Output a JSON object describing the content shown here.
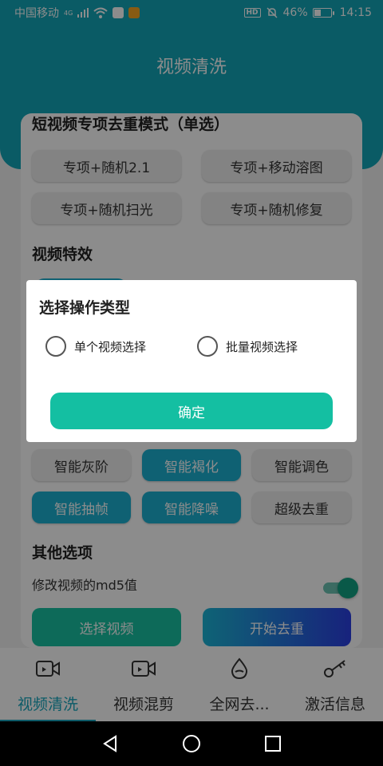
{
  "status_bar": {
    "carrier": "中国移动",
    "network": "4G",
    "battery_percent": "46%",
    "battery_level": 0.46,
    "time": "14:15",
    "hd_label": "HD"
  },
  "header": {
    "title": "视频清洗"
  },
  "sections": {
    "dedupe_mode": {
      "title": "短视频专项去重模式（单选）",
      "options": [
        "专项+随机2.1",
        "专项+移动溶图",
        "专项+随机扫光",
        "专项+随机修复"
      ]
    },
    "effects": {
      "title": "视频特效",
      "chips": [
        {
          "label": "智能灰阶",
          "active": false
        },
        {
          "label": "智能褐化",
          "active": true
        },
        {
          "label": "智能调色",
          "active": false
        },
        {
          "label": "智能抽帧",
          "active": true
        },
        {
          "label": "智能降噪",
          "active": true
        },
        {
          "label": "超级去重",
          "active": false
        }
      ]
    },
    "other": {
      "title": "其他选项",
      "md5_label": "修改视频的md5值",
      "md5_enabled": true
    }
  },
  "buttons": {
    "select_video": "选择视频",
    "start_dedupe": "开始去重"
  },
  "bottom_nav": [
    {
      "label": "视频清洗",
      "icon": "video-camera-icon",
      "active": true
    },
    {
      "label": "视频混剪",
      "icon": "video-camera-icon",
      "active": false
    },
    {
      "label": "全网去...",
      "icon": "water-drop-icon",
      "active": false
    },
    {
      "label": "激活信息",
      "icon": "key-icon",
      "active": false
    }
  ],
  "dialog": {
    "title": "选择操作类型",
    "options": [
      "单个视频选择",
      "批量视频选择"
    ],
    "confirm_label": "确定"
  },
  "colors": {
    "primary": "#13a6b8",
    "chip_active": "#1cb1d1",
    "confirm": "#14bfa2",
    "gradient_end": "#2b3fe3"
  }
}
